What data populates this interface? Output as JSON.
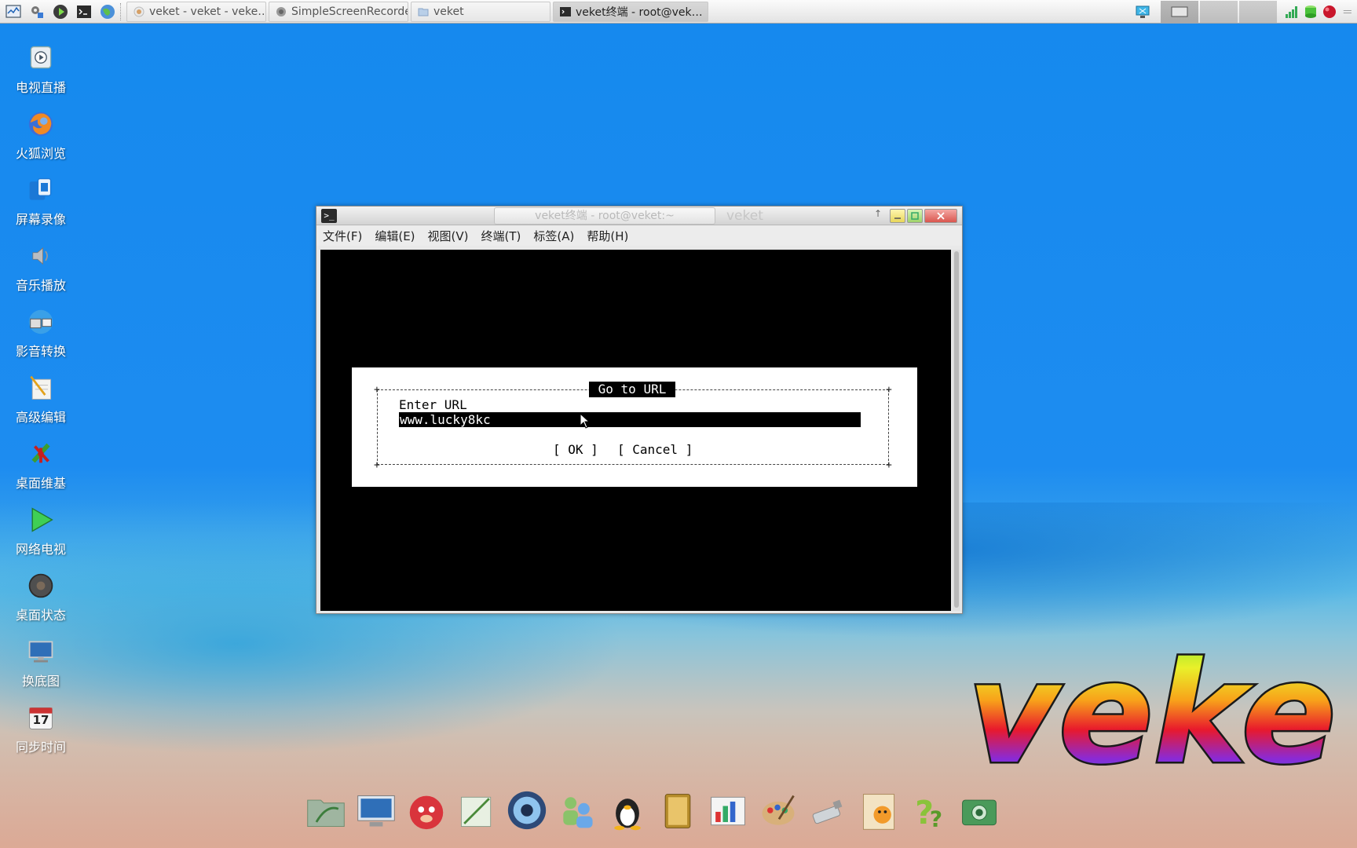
{
  "taskbar": {
    "tasks": [
      {
        "label": "veket - veket - veke…",
        "active": false
      },
      {
        "label": "SimpleScreenRecorder",
        "active": false
      },
      {
        "label": "veket",
        "active": false
      },
      {
        "label": "veket终端 - root@vek…",
        "active": true
      }
    ]
  },
  "desktop_icons": [
    {
      "label": "电视直播",
      "icon": "tv-live-icon"
    },
    {
      "label": "火狐浏览",
      "icon": "firefox-icon"
    },
    {
      "label": "屏幕录像",
      "icon": "screen-record-icon"
    },
    {
      "label": "音乐播放",
      "icon": "music-player-icon"
    },
    {
      "label": "影音转换",
      "icon": "media-convert-icon"
    },
    {
      "label": "高级编辑",
      "icon": "text-editor-icon"
    },
    {
      "label": "桌面维基",
      "icon": "desktop-wiki-icon"
    },
    {
      "label": "网络电视",
      "icon": "network-tv-icon"
    },
    {
      "label": "桌面状态",
      "icon": "desktop-status-icon"
    },
    {
      "label": "换底图",
      "icon": "wallpaper-icon"
    },
    {
      "label": "同步时间",
      "icon": "calendar-icon"
    }
  ],
  "window": {
    "tab_title": "veket终端 - root@veket:~",
    "title": "veket",
    "menu": [
      "文件(F)",
      "编辑(E)",
      "视图(V)",
      "终端(T)",
      "标签(A)",
      "帮助(H)"
    ]
  },
  "dialog": {
    "title": "Go to URL",
    "label": "Enter URL",
    "input_value": "www.lucky8kc",
    "ok": "[ OK ]",
    "cancel": "[ Cancel ]"
  },
  "calendar_day": "17",
  "logo_text": "veke",
  "colors": {
    "desktop_blue": "#1589ee",
    "close_red": "#d9574f"
  }
}
